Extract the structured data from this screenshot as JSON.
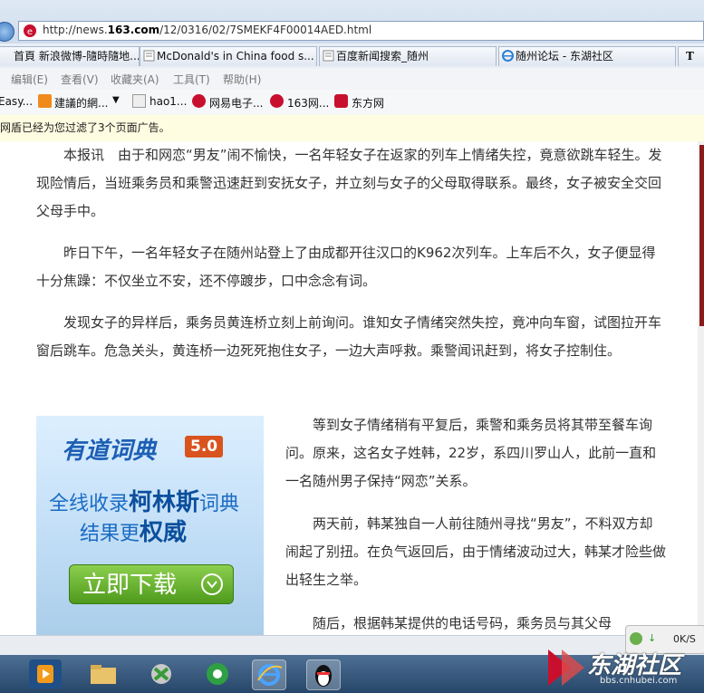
{
  "browser": {
    "url_prefix": "http://news.",
    "url_domain": "163.com",
    "url_suffix": "/12/0316/02/7SMEKF4F00014AED.html",
    "tabs": [
      {
        "label": "首頁 新浪微博-隨時隨地..."
      },
      {
        "label": "McDonald's in China food s..."
      },
      {
        "label": "百度新闻搜索_随州"
      },
      {
        "label": "随州论坛 - 东湖社区"
      },
      {
        "label": "T"
      }
    ],
    "menu": [
      "编辑(E)",
      "查看(V)",
      "收藏夹(A)",
      "工具(T)",
      "帮助(H)"
    ],
    "favorites": [
      "Easy...",
      "建議的網...",
      "hao1...",
      "网易电子...",
      "163网...",
      "东方网"
    ],
    "notice": "网盾已经为您过滤了3个页面广告。"
  },
  "article": {
    "p1": "本报讯　由于和网恋“男友”闹不愉快，一名年轻女子在返家的列车上情绪失控，竟意欲跳车轻生。发现险情后，当班乘务员和乘警迅速赶到安抚女子，并立刻与女子的父母取得联系。最终，女子被安全交回父母手中。",
    "p2": "昨日下午，一名年轻女子在随州站登上了由成都开往汉口的K962次列车。上车后不久，女子便显得十分焦躁：不仅坐立不安，还不停踱步，口中念念有词。",
    "p3": "发现女子的异样后，乘务员黄连桥立刻上前询问。谁知女子情绪突然失控，竟冲向车窗，试图拉开车窗后跳车。危急关头，黄连桥一边死死抱住女子，一边大声呼救。乘警闻讯赶到，将女子控制住。",
    "p4": "等到女子情绪稍有平复后，乘警和乘务员将其带至餐车询问。原来，这名女子姓韩，22岁，系四川罗山人，此前一直和一名随州男子保持“网恋”关系。",
    "p5": "两天前，韩某独自一人前往随州寻找“男友”，不料双方却闹起了别扭。在负气返回后，由于情绪波动过大，韩某才险些做出轻生之举。",
    "p6": "随后，根据韩某提供的电话号码，乘务员与其父母"
  },
  "ad": {
    "brand": "有道",
    "product": "词典",
    "version": "5.0",
    "line1_a": "全线收录",
    "line1_b": "柯林斯",
    "line1_c": "词典",
    "line2_a": "结果更",
    "line2_b": "权威",
    "button": "立即下载"
  },
  "status": {
    "speed": "0K/S"
  },
  "watermark": {
    "title": "东湖社区",
    "url": "bbs.cnhubei.com"
  },
  "colors": {
    "accent": "#1a6cc4",
    "notice_bg": "#fffde1",
    "taskbar": "#27476a"
  }
}
